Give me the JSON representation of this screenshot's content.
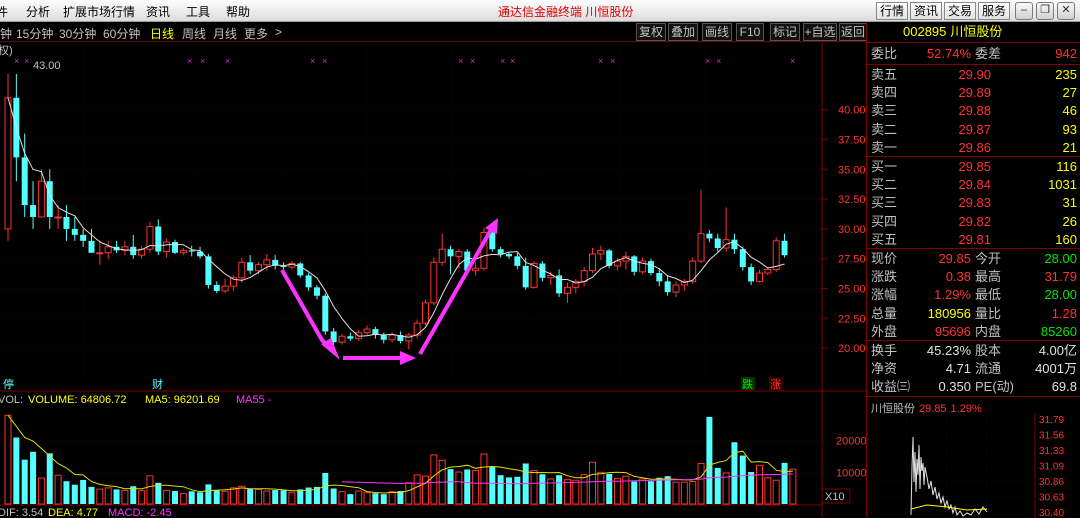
{
  "menu": [
    "分析",
    "扩展市场行情",
    "资讯",
    "工具",
    "帮助"
  ],
  "window_title": "通达信金融终端   川恒股份",
  "right_menu": [
    "行情",
    "资讯",
    "交易",
    "服务"
  ],
  "periods": [
    "钟",
    "15分钟",
    "30分钟",
    "60分钟",
    "日线",
    "周线",
    "月线",
    "更多",
    ">"
  ],
  "active_period": "日线",
  "toolbar": [
    "复权",
    "叠加",
    "画线",
    "F10",
    "标记",
    "+自选",
    "返回"
  ],
  "chart_corner": "权)",
  "chart_data": {
    "type": "candlestick",
    "peak_label": "43.00",
    "yaxis_ticks": [
      "40.00",
      "37.50",
      "35.00",
      "32.50",
      "30.00",
      "27.50",
      "25.00",
      "22.50",
      "20.00"
    ],
    "ylim": [
      18.0,
      44.0
    ],
    "up_color": "#ff3232",
    "down_color": "#54ffff",
    "candles": [
      [
        30,
        43,
        29,
        41
      ],
      [
        41,
        43,
        34,
        36
      ],
      [
        36,
        38,
        31,
        32
      ],
      [
        32,
        34,
        30,
        31
      ],
      [
        31,
        35,
        31,
        34
      ],
      [
        34,
        35,
        30,
        31
      ],
      [
        31,
        32,
        30,
        31
      ],
      [
        31,
        32,
        29,
        30
      ],
      [
        30,
        31,
        29,
        29.5
      ],
      [
        29.5,
        30,
        28.5,
        29
      ],
      [
        29,
        30,
        28,
        28
      ],
      [
        28,
        29,
        27,
        28
      ],
      [
        28,
        29,
        27.5,
        28.5
      ],
      [
        28.5,
        29,
        28,
        28.2
      ],
      [
        28.2,
        29,
        27.8,
        28.5
      ],
      [
        28.5,
        29.5,
        27.5,
        27.8
      ],
      [
        27.8,
        28.6,
        27.5,
        28.3
      ],
      [
        28.3,
        30.6,
        28,
        30.2
      ],
      [
        30.2,
        30.8,
        27.8,
        28.1
      ],
      [
        28.1,
        29.2,
        27.6,
        28.9
      ],
      [
        28.9,
        29.1,
        27.9,
        28
      ],
      [
        28,
        28.4,
        27.8,
        28.2
      ],
      [
        28.2,
        28.6,
        27.7,
        28.1
      ],
      [
        28.1,
        28.5,
        27.5,
        27.7
      ],
      [
        27.7,
        27.9,
        25,
        25.3
      ],
      [
        25.3,
        25.6,
        24.6,
        24.8
      ],
      [
        24.8,
        25.8,
        24.6,
        25.2
      ],
      [
        25.2,
        26.1,
        24.8,
        25.9
      ],
      [
        25.9,
        27.6,
        25.5,
        27.2
      ],
      [
        27.2,
        27.8,
        26.2,
        26.5
      ],
      [
        26.5,
        27.2,
        26.2,
        27
      ],
      [
        27,
        27.9,
        26.5,
        27.4
      ],
      [
        27.4,
        27.8,
        26.6,
        26.9
      ],
      [
        26.9,
        27.2,
        26.5,
        26.8
      ],
      [
        26.8,
        27.3,
        26.6,
        27.1
      ],
      [
        27.1,
        27.2,
        25.9,
        26.1
      ],
      [
        26.1,
        26.3,
        24.8,
        25.1
      ],
      [
        25.1,
        25.3,
        24.1,
        24.4
      ],
      [
        24.4,
        24.6,
        21.1,
        21.4
      ],
      [
        21.4,
        21.7,
        20.2,
        20.5
      ],
      [
        20.5,
        21.2,
        20.3,
        21
      ],
      [
        21,
        21.3,
        20.6,
        20.8
      ],
      [
        20.8,
        21.5,
        20.6,
        21.3
      ],
      [
        21.3,
        21.9,
        21,
        21.6
      ],
      [
        21.6,
        21.8,
        20.8,
        21.1
      ],
      [
        21.1,
        21.3,
        20.4,
        20.7
      ],
      [
        20.7,
        21.3,
        20.5,
        21.1
      ],
      [
        21.1,
        21.4,
        20.4,
        20.6
      ],
      [
        20.6,
        21.3,
        19.9,
        21.1
      ],
      [
        21.1,
        22.4,
        20.8,
        22.1
      ],
      [
        22.1,
        24.1,
        21.9,
        23.8
      ],
      [
        23.8,
        27.6,
        23.6,
        27.2
      ],
      [
        27.2,
        29.6,
        26.9,
        28.3
      ],
      [
        28.3,
        28.6,
        26.2,
        27.7
      ],
      [
        27.7,
        28.3,
        26.7,
        28.1
      ],
      [
        28.1,
        28.3,
        26.2,
        26.5
      ],
      [
        26.5,
        27.2,
        26.1,
        26.7
      ],
      [
        26.7,
        30.1,
        26.5,
        29.7
      ],
      [
        29.7,
        29.8,
        28.1,
        28.3
      ],
      [
        28.3,
        28.5,
        27.6,
        27.9
      ],
      [
        27.9,
        28.1,
        27.5,
        27.7
      ],
      [
        27.7,
        28,
        26.6,
        26.9
      ],
      [
        26.9,
        27.6,
        24.9,
        25.1
      ],
      [
        25.1,
        27.3,
        25,
        27.1
      ],
      [
        27.1,
        27.3,
        25.6,
        25.9
      ],
      [
        25.9,
        26.4,
        25.3,
        26.1
      ],
      [
        26.1,
        26.6,
        24.3,
        24.6
      ],
      [
        24.6,
        25.5,
        23.8,
        25.1
      ],
      [
        25.1,
        25.8,
        24.6,
        25.6
      ],
      [
        25.6,
        26.8,
        25.2,
        26.5
      ],
      [
        26.5,
        28.4,
        26.3,
        27.9
      ],
      [
        27.9,
        28.6,
        27.4,
        28.2
      ],
      [
        28.2,
        28.3,
        26.7,
        26.9
      ],
      [
        26.9,
        27.6,
        26.5,
        27.3
      ],
      [
        27.3,
        28.1,
        26.6,
        27.7
      ],
      [
        27.7,
        27.8,
        26.1,
        26.4
      ],
      [
        26.4,
        27.6,
        26.2,
        27.3
      ],
      [
        27.3,
        27.5,
        26.1,
        26.3
      ],
      [
        26.3,
        26.7,
        25.2,
        25.6
      ],
      [
        25.6,
        26.1,
        24.4,
        24.7
      ],
      [
        24.7,
        25.6,
        24.3,
        25.3
      ],
      [
        25.3,
        25.8,
        24.8,
        25.6
      ],
      [
        25.6,
        27.6,
        25.4,
        27.3
      ],
      [
        27.3,
        33.3,
        27.1,
        29.6
      ],
      [
        29.6,
        29.9,
        28.9,
        29.2
      ],
      [
        29.2,
        29.6,
        28.1,
        28.4
      ],
      [
        28.4,
        31.8,
        28.1,
        29.1
      ],
      [
        29.1,
        29.6,
        27.9,
        28.3
      ],
      [
        28.3,
        28.5,
        26.5,
        26.8
      ],
      [
        26.8,
        27.1,
        25.3,
        25.6
      ],
      [
        25.6,
        26.6,
        25.5,
        26.3
      ],
      [
        26.3,
        26.8,
        26.1,
        26.6
      ],
      [
        26.6,
        29.3,
        26.4,
        29
      ],
      [
        29,
        29.6,
        27.6,
        27.8
      ]
    ],
    "markers": {
      "limit_up_tag": "停",
      "finance_tag": "财",
      "fall_tag": "跌",
      "rise_tag": "涨"
    },
    "volume_panel": {
      "label_vol": "VOL:",
      "volume_label": "VOLUME: 64806.72",
      "ma5_label": "MA5: 96201.69",
      "ma55_label": "MA55 -",
      "yaxis_ticks": [
        "20000",
        "10000"
      ],
      "unit": "X10",
      "ylim": [
        0,
        30000
      ],
      "values": [
        28000,
        21000,
        14000,
        16500,
        8200,
        16000,
        9100,
        7200,
        6100,
        7600,
        5400,
        4700,
        5100,
        4600,
        4300,
        5600,
        4200,
        8900,
        6700,
        4300,
        4100,
        3300,
        4000,
        3700,
        6200,
        4500,
        4000,
        5100,
        5600,
        4800,
        4600,
        4100,
        4400,
        4300,
        3600,
        4600,
        5200,
        5400,
        9800,
        4900,
        3900,
        3100,
        4100,
        3600,
        3400,
        3100,
        3900,
        4100,
        6700,
        9200,
        8800,
        15500,
        13800,
        11000,
        10100,
        10900,
        10600,
        15800,
        11800,
        9100,
        8400,
        8600,
        12800,
        10600,
        9400,
        7900,
        9100,
        7700,
        7500,
        9300,
        13200,
        10000,
        9500,
        8100,
        8800,
        7100,
        7900,
        7200,
        8300,
        8800,
        6900,
        6900,
        7100,
        12800,
        27500,
        11400,
        9800,
        19500,
        15300,
        10100,
        12200,
        8300,
        7500,
        13000,
        11000
      ]
    },
    "macd_panel": {
      "dif_label": "DIF: 3.54",
      "dea_label": "DEA: 4.77",
      "macd_label": "MACD: -2.45"
    }
  },
  "quote": {
    "code": "002895",
    "name": "川恒股份",
    "weibi_label": "委比",
    "weibi": "52.74%",
    "weicha_label": "委差",
    "weicha": "942",
    "asks": [
      {
        "label": "卖五",
        "price": "29.90",
        "vol": "235"
      },
      {
        "label": "卖四",
        "price": "29.89",
        "vol": "27"
      },
      {
        "label": "卖三",
        "price": "29.88",
        "vol": "46"
      },
      {
        "label": "卖二",
        "price": "29.87",
        "vol": "93"
      },
      {
        "label": "卖一",
        "price": "29.86",
        "vol": "21"
      }
    ],
    "bids": [
      {
        "label": "买一",
        "price": "29.85",
        "vol": "116"
      },
      {
        "label": "买二",
        "price": "29.84",
        "vol": "1031"
      },
      {
        "label": "买三",
        "price": "29.83",
        "vol": "31"
      },
      {
        "label": "买四",
        "price": "29.82",
        "vol": "26"
      },
      {
        "label": "买五",
        "price": "29.81",
        "vol": "160"
      }
    ],
    "stats": [
      {
        "l1": "现价",
        "v1": "29.85",
        "c1": "red",
        "l2": "今开",
        "v2": "28.00",
        "c2": "green"
      },
      {
        "l1": "涨跌",
        "v1": "0.38",
        "c1": "red",
        "l2": "最高",
        "v2": "31.79",
        "c2": "red"
      },
      {
        "l1": "涨幅",
        "v1": "1.29%",
        "c1": "red",
        "l2": "最低",
        "v2": "28.00",
        "c2": "green"
      },
      {
        "l1": "总量",
        "v1": "180956",
        "c1": "yellow",
        "l2": "量比",
        "v2": "1.28",
        "c2": "red"
      },
      {
        "l1": "外盘",
        "v1": "95696",
        "c1": "red",
        "l2": "内盘",
        "v2": "85260",
        "c2": "green"
      }
    ],
    "stats2": [
      {
        "l1": "换手",
        "v1": "45.23%",
        "l2": "股本",
        "v2": "4.00亿"
      },
      {
        "l1": "净资",
        "v1": "4.71",
        "l2": "流通",
        "v2": "4001万"
      },
      {
        "l1": "收益㈢",
        "v1": "0.350",
        "l2": "PE(动)",
        "v2": "69.8"
      }
    ]
  },
  "mini": {
    "name": "川恒股份",
    "price": "29.85",
    "pct": "1.29%",
    "yaxis_ticks": [
      "31.79",
      "31.56",
      "31.33",
      "31.09",
      "30.86",
      "30.63",
      "30.40"
    ]
  }
}
